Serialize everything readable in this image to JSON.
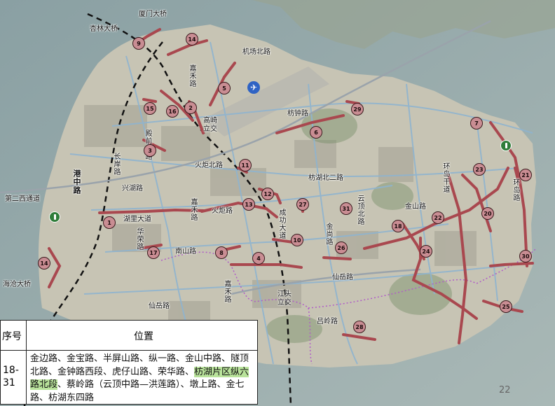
{
  "colors": {
    "route": "#a9484f",
    "badge": "#c98d93",
    "metro": "#2f7d3a",
    "airport": "#2f63c4",
    "purple_boundary": "#b05cc8",
    "dashed": "#111111"
  },
  "labels": [
    {
      "text": "杏林大桥",
      "vertical": false
    },
    {
      "text": "厦门大桥",
      "vertical": false
    },
    {
      "text": "机场北路",
      "vertical": false
    },
    {
      "text": "嘉禾路",
      "vertical": true
    },
    {
      "text": "高崎",
      "vertical": false
    },
    {
      "text": "立交",
      "vertical": false
    },
    {
      "text": "枋钟路",
      "vertical": false
    },
    {
      "text": "殿前一路",
      "vertical": true
    },
    {
      "text": "长岸路",
      "vertical": true
    },
    {
      "text": "港中路",
      "vertical": true
    },
    {
      "text": "兴湖路",
      "vertical": false
    },
    {
      "text": "火炬北路",
      "vertical": false
    },
    {
      "text": "枋湖北二路",
      "vertical": false
    },
    {
      "text": "云顶北路",
      "vertical": true
    },
    {
      "text": "环岛干道",
      "vertical": true
    },
    {
      "text": "环岛路",
      "vertical": true
    },
    {
      "text": "第二西通道",
      "vertical": false
    },
    {
      "text": "湖里大道",
      "vertical": false
    },
    {
      "text": "嘉禾路",
      "vertical": true
    },
    {
      "text": "火炬路",
      "vertical": false
    },
    {
      "text": "成功大道",
      "vertical": true
    },
    {
      "text": "金山路",
      "vertical": false
    },
    {
      "text": "金尚路",
      "vertical": true
    },
    {
      "text": "华荣路",
      "vertical": true
    },
    {
      "text": "南山路",
      "vertical": false
    },
    {
      "text": "海沧大桥",
      "vertical": false
    },
    {
      "text": "仙岳路",
      "vertical": false
    },
    {
      "text": "嘉禾路",
      "vertical": true
    },
    {
      "text": "江头",
      "vertical": false
    },
    {
      "text": "立交",
      "vertical": false
    },
    {
      "text": "仙岳路",
      "vertical": false
    },
    {
      "text": "吕岭路",
      "vertical": false
    }
  ],
  "badges": [
    "9",
    "14",
    "5",
    "15",
    "16",
    "2",
    "29",
    "3",
    "6",
    "7",
    "11",
    "23",
    "21",
    "12",
    "13",
    "27",
    "31",
    "22",
    "20",
    "1",
    "10",
    "26",
    "18",
    "24",
    "17",
    "8",
    "4",
    "30",
    "14",
    "25",
    "28"
  ],
  "legend": {
    "header_id": "序号",
    "header_location": "位置",
    "row_id": "18-31",
    "location_part1": "金边路、金宝路、半屏山路、纵一路、金山中路、隧顶北路、金钟路西段、虎仔山路、荣华路、",
    "location_highlight": "枋湖片区纵六路北段",
    "location_part2": "、蔡岭路（云顶中路—洪莲路）、墩上路、金七路、枋湖东四路"
  },
  "page_number": "22"
}
